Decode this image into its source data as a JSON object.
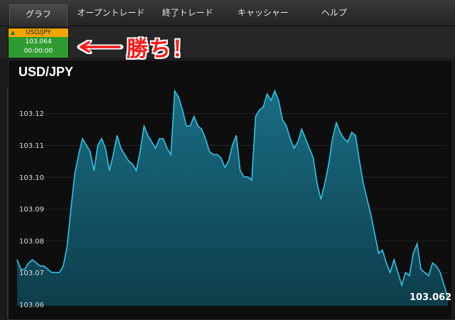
{
  "tabs": [
    {
      "label": "グラフ",
      "active": true
    },
    {
      "label": "オープントレード",
      "active": false
    },
    {
      "label": "終了トレード",
      "active": false
    },
    {
      "label": "キャッシャー",
      "active": false
    },
    {
      "label": "ヘルプ",
      "active": false
    }
  ],
  "ticker": {
    "symbol": "USD/JPY",
    "price": "103.064",
    "timer": "00:00:00",
    "direction_icon": "up-triangle-icon"
  },
  "annotation": {
    "text": "勝ち！",
    "arrow_icon": "left-arrow-icon",
    "color": "#ff1a1a"
  },
  "colors": {
    "line": "#2ec4ea",
    "fill_top": "#1a6d84",
    "fill_bottom": "#0d3d4a",
    "ticker_head": "#f0a500",
    "ticker_body": "#2e9c30"
  },
  "chart_data": {
    "type": "area",
    "title": "USD/JPY",
    "y_ticks": [
      "103.12",
      "103.11",
      "103.10",
      "103.09",
      "103.08",
      "103.07",
      "103.06"
    ],
    "ylim": [
      103.06,
      103.128
    ],
    "grid": true,
    "last_price_label": "103.062",
    "values": [
      103.074,
      103.071,
      103.071,
      103.073,
      103.074,
      103.073,
      103.072,
      103.072,
      103.071,
      103.07,
      103.07,
      103.07,
      103.072,
      103.078,
      103.09,
      103.101,
      103.107,
      103.112,
      103.11,
      103.108,
      103.102,
      103.11,
      103.112,
      103.109,
      103.102,
      103.107,
      103.113,
      103.109,
      103.107,
      103.105,
      103.104,
      103.102,
      103.108,
      103.116,
      103.113,
      103.111,
      103.109,
      103.112,
      103.112,
      103.109,
      103.107,
      103.127,
      103.125,
      103.121,
      103.116,
      103.116,
      103.119,
      103.116,
      103.115,
      103.112,
      103.108,
      103.107,
      103.107,
      103.106,
      103.103,
      103.105,
      103.11,
      103.113,
      103.102,
      103.1,
      103.1,
      103.099,
      103.119,
      103.121,
      103.122,
      103.126,
      103.124,
      103.127,
      103.124,
      103.118,
      103.116,
      103.112,
      103.109,
      103.111,
      103.115,
      103.112,
      103.109,
      103.106,
      103.098,
      103.093,
      103.098,
      103.104,
      103.112,
      103.117,
      103.114,
      103.112,
      103.111,
      103.114,
      103.113,
      103.105,
      103.098,
      103.093,
      103.088,
      103.082,
      103.076,
      103.077,
      103.073,
      103.07,
      103.074,
      103.07,
      103.066,
      103.07,
      103.069,
      103.076,
      103.079,
      103.071,
      103.07,
      103.069,
      103.073,
      103.072,
      103.07,
      103.066,
      103.062
    ]
  }
}
